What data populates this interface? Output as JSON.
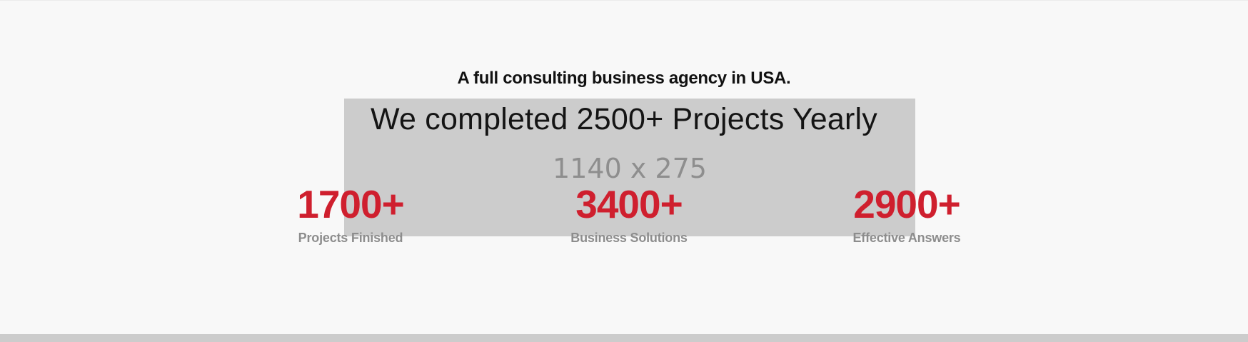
{
  "section": {
    "subtitle": "A full consulting business agency in USA.",
    "headline": "We completed 2500+ Projects Yearly",
    "placeholder_label": "1140 x 275"
  },
  "stats": [
    {
      "value": "1700+",
      "label": "Projects Finished"
    },
    {
      "value": "3400+",
      "label": "Business Solutions"
    },
    {
      "value": "2900+",
      "label": "Effective Answers"
    }
  ],
  "colors": {
    "page_background": "#f8f8f8",
    "placeholder_background": "#cccccc",
    "stat_accent": "#cf1f2e",
    "stat_label": "#8d8d8d",
    "headline_text": "#141414"
  }
}
